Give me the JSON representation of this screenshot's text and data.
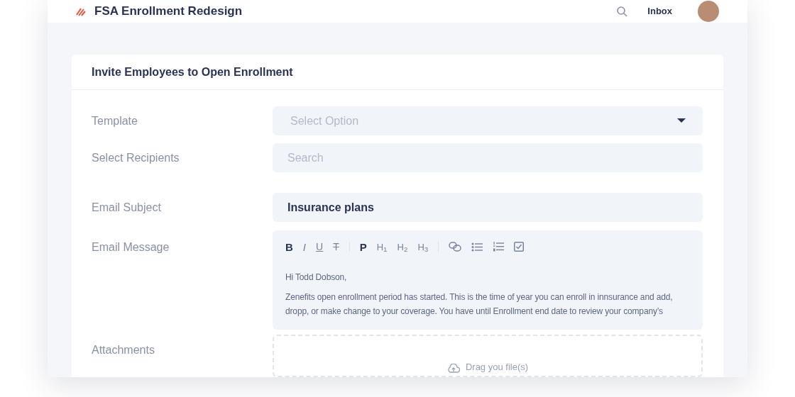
{
  "header": {
    "title": "FSA Enrollment Redesign",
    "inbox": "Inbox"
  },
  "card": {
    "title": "Invite Employees to Open Enrollment"
  },
  "form": {
    "fields": [
      {
        "kind": "select",
        "label": "Template",
        "placeholder": "Select Option"
      },
      {
        "kind": "search",
        "label": "Select Recipients",
        "placeholder": "Search"
      },
      {
        "kind": "text",
        "label": "Email Subject",
        "value": "Insurance plans"
      }
    ],
    "message": {
      "label": "Email Message",
      "toolbar": [
        {
          "kind": "bold",
          "label": "B"
        },
        {
          "kind": "italic",
          "label": "I"
        },
        {
          "kind": "underline",
          "label": "U"
        },
        {
          "kind": "strike",
          "label": "T"
        },
        {
          "kind": "divider"
        },
        {
          "kind": "paragraph",
          "label": "P"
        },
        {
          "kind": "heading",
          "label": "H",
          "sub": "1"
        },
        {
          "kind": "heading",
          "label": "H",
          "sub": "2"
        },
        {
          "kind": "heading",
          "label": "H",
          "sub": "3"
        },
        {
          "kind": "divider"
        },
        {
          "kind": "link"
        },
        {
          "kind": "bullets"
        },
        {
          "kind": "numbers"
        },
        {
          "kind": "checkbox"
        }
      ],
      "paragraphs": [
        "Hi Todd Dobson,",
        "Zenefits open enrollment period has started. This is the time of year you can enroll in innsurance and add, dropp, or make change to your coverage. You have until Enrollment end date to review your company’s"
      ]
    },
    "attachments": {
      "label": "Attachments",
      "drop_text": "Drag you file(s)"
    }
  }
}
